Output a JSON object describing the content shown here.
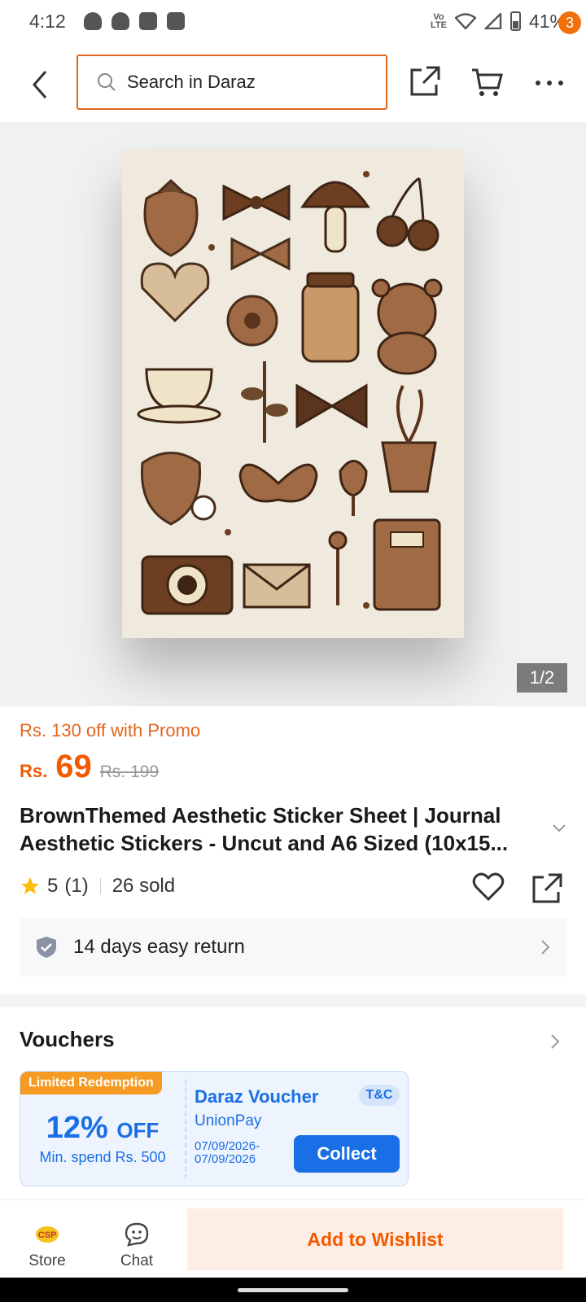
{
  "status_bar": {
    "time": "4:12",
    "network": "LTE",
    "battery": "41%"
  },
  "header": {
    "search_placeholder": "Search in Daraz",
    "cart_badge": "3"
  },
  "gallery": {
    "counter": "1/2"
  },
  "product": {
    "promo": "Rs. 130 off with Promo",
    "currency": "Rs.",
    "price": "69",
    "original_price": "Rs. 199",
    "title": "BrownThemed Aesthetic Sticker Sheet | Journal Aesthetic Stickers - Uncut and A6 Sized (10x15...",
    "rating": "5",
    "rating_count": "(1)",
    "sold": "26 sold",
    "returns": "14 days easy return"
  },
  "vouchers": {
    "section_title": "Vouchers",
    "tag": "Limited Redemption",
    "discount": "12%",
    "discount_suffix": "OFF",
    "min_spend": "Min. spend Rs. 500",
    "name": "Daraz Voucher",
    "tc": "T&C",
    "issuer": "UnionPay",
    "validity": "07/09/2026-07/09/2026",
    "collect_label": "Collect"
  },
  "bottom_bar": {
    "store_label": "Store",
    "chat_label": "Chat",
    "wishlist_label": "Add to Wishlist"
  },
  "colors": {
    "brand_orange": "#f35a00",
    "voucher_blue": "#1a6ee6"
  }
}
